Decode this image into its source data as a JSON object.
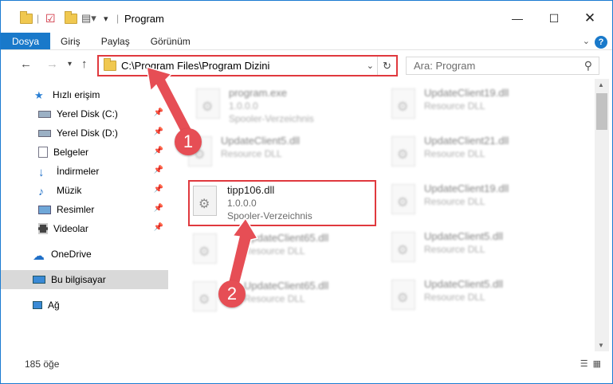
{
  "window": {
    "title": "Program"
  },
  "ribbon": {
    "tabs": [
      "Dosya",
      "Giriş",
      "Paylaş",
      "Görünüm"
    ],
    "help_label": "?"
  },
  "address": {
    "path": "C:\\Program Files\\Program Dizini"
  },
  "search": {
    "placeholder": "Ara: Program"
  },
  "sidebar": {
    "quick_access": "Hızlı erişim",
    "items": [
      {
        "label": "Yerel Disk (C:)",
        "icon": "drive-icon"
      },
      {
        "label": "Yerel Disk (D:)",
        "icon": "drive-icon"
      },
      {
        "label": "Belgeler",
        "icon": "documents-icon"
      },
      {
        "label": "İndirmeler",
        "icon": "downloads-icon"
      },
      {
        "label": "Müzik",
        "icon": "music-icon"
      },
      {
        "label": "Resimler",
        "icon": "pictures-icon"
      },
      {
        "label": "Videolar",
        "icon": "videos-icon"
      }
    ],
    "onedrive": "OneDrive",
    "this_pc": "Bu bilgisayar",
    "network": "Ağ"
  },
  "files": {
    "left": [
      {
        "name": "program.exe",
        "line2": "1.0.0.0",
        "line3": "Spooler-Verzeichnis"
      },
      {
        "name": "UpdateClient5.dll",
        "line2": "Resource DLL",
        "line3": ""
      },
      {
        "name": "tipp106.dll",
        "line2": "1.0.0.0",
        "line3": "Spooler-Verzeichnis"
      },
      {
        "name": "UpdateClient65.dll",
        "line2": "Resource DLL",
        "line3": ""
      },
      {
        "name": "UpdateClient65.dll",
        "line2": "Resource DLL",
        "line3": ""
      }
    ],
    "right": [
      {
        "name": "UpdateClient19.dll",
        "line2": "Resource DLL"
      },
      {
        "name": "UpdateClient21.dll",
        "line2": "Resource DLL"
      },
      {
        "name": "UpdateClient19.dll",
        "line2": "Resource DLL"
      },
      {
        "name": "UpdateClient5.dll",
        "line2": "Resource DLL"
      },
      {
        "name": "UpdateClient5.dll",
        "line2": "Resource DLL"
      }
    ]
  },
  "status": {
    "count": "185 öğe"
  },
  "annotations": {
    "step1": "1",
    "step2": "2",
    "color": "#e64e55"
  }
}
